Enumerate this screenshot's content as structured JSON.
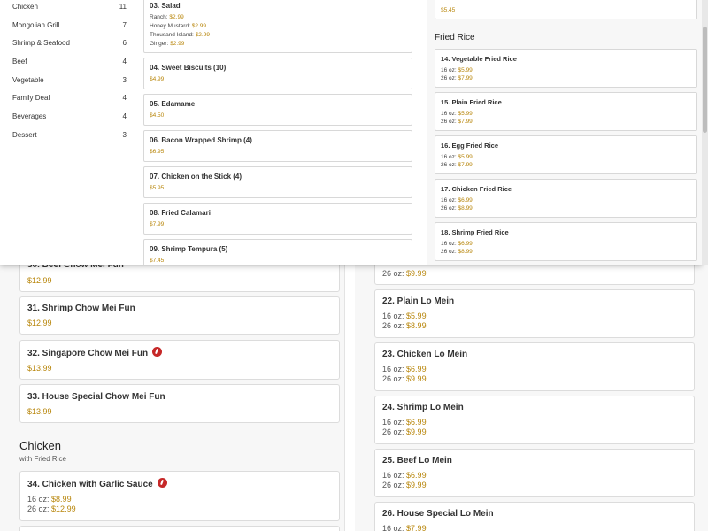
{
  "categories": [
    {
      "name": "Chicken",
      "count": "11"
    },
    {
      "name": "Mongolian Grill",
      "count": "7"
    },
    {
      "name": "Shrimp & Seafood",
      "count": "6"
    },
    {
      "name": "Beef",
      "count": "4"
    },
    {
      "name": "Vegetable",
      "count": "3"
    },
    {
      "name": "Family Deal",
      "count": "4"
    },
    {
      "name": "Beverages",
      "count": "4"
    },
    {
      "name": "Dessert",
      "count": "3"
    }
  ],
  "appetizers": {
    "salad": {
      "title": "03. Salad",
      "options": [
        {
          "label": "Ranch:",
          "price": "$2.99"
        },
        {
          "label": "Honey Mustard:",
          "price": "$2.99"
        },
        {
          "label": "Thousand Island:",
          "price": "$2.99"
        },
        {
          "label": "Ginger:",
          "price": "$2.99"
        }
      ]
    },
    "items": [
      {
        "title": "04. Sweet Biscuits (10)",
        "price": "$4.99"
      },
      {
        "title": "05. Edamame",
        "price": "$4.50"
      },
      {
        "title": "06. Bacon Wrapped Shrimp (4)",
        "price": "$6.95"
      },
      {
        "title": "07. Chicken on the Stick (4)",
        "price": "$5.95"
      },
      {
        "title": "08. Fried Calamari",
        "price": "$7.99"
      },
      {
        "title": "09. Shrimp Tempura (5)",
        "price": "$7.45"
      }
    ]
  },
  "fried_rice": {
    "top_price": "$5.45",
    "section_title": "Fried Rice",
    "items": [
      {
        "title": "14. Vegetable Fried Rice",
        "s16": "16 oz:",
        "p16": "$5.99",
        "s26": "26 oz:",
        "p26": "$7.99"
      },
      {
        "title": "15. Plain Fried Rice",
        "s16": "16 oz:",
        "p16": "$5.99",
        "s26": "26 oz:",
        "p26": "$7.99"
      },
      {
        "title": "16. Egg Fried Rice",
        "s16": "16 oz:",
        "p16": "$5.99",
        "s26": "26 oz:",
        "p26": "$7.99"
      },
      {
        "title": "17. Chicken Fried Rice",
        "s16": "16 oz:",
        "p16": "$6.99",
        "s26": "26 oz:",
        "p26": "$8.99"
      },
      {
        "title": "18. Shrimp Fried Rice",
        "s16": "16 oz:",
        "p16": "$6.99",
        "s26": "26 oz:",
        "p26": "$8.99"
      }
    ]
  },
  "chow_mei_fun": {
    "partial_title": "30. Beef Chow Mei Fun",
    "partial_price": "$12.99",
    "items": [
      {
        "title": "31. Shrimp Chow Mei Fun",
        "price": "$12.99",
        "spicy": false
      },
      {
        "title": "32. Singapore Chow Mei Fun",
        "price": "$13.99",
        "spicy": true
      },
      {
        "title": "33. House Special Chow Mei Fun",
        "price": "$13.99",
        "spicy": false
      }
    ]
  },
  "chicken_section": {
    "title": "Chicken",
    "subtitle": "with Fried Rice",
    "item": {
      "title": "34. Chicken with Garlic Sauce",
      "s16": "16 oz:",
      "p16": "$8.99",
      "s26": "26 oz:",
      "p26": "$12.99"
    }
  },
  "lo_mein": {
    "partial_s26": "26 oz:",
    "partial_p26": "$9.99",
    "items": [
      {
        "title": "22. Plain Lo Mein",
        "s16": "16 oz:",
        "p16": "$5.99",
        "s26": "26 oz:",
        "p26": "$8.99"
      },
      {
        "title": "23. Chicken Lo Mein",
        "s16": "16 oz:",
        "p16": "$6.99",
        "s26": "26 oz:",
        "p26": "$9.99"
      },
      {
        "title": "24. Shrimp Lo Mein",
        "s16": "16 oz:",
        "p16": "$6.99",
        "s26": "26 oz:",
        "p26": "$9.99"
      },
      {
        "title": "25. Beef Lo Mein",
        "s16": "16 oz:",
        "p16": "$6.99",
        "s26": "26 oz:",
        "p26": "$9.99"
      },
      {
        "title": "26. House Special Lo Mein",
        "s16": "16 oz:",
        "p16": "$7.99"
      }
    ]
  },
  "colors": {
    "price": "#b8860b",
    "spicy": "#c62828",
    "background": "#f7f7f7"
  },
  "icons": {
    "spicy": "chili-pepper-icon"
  }
}
